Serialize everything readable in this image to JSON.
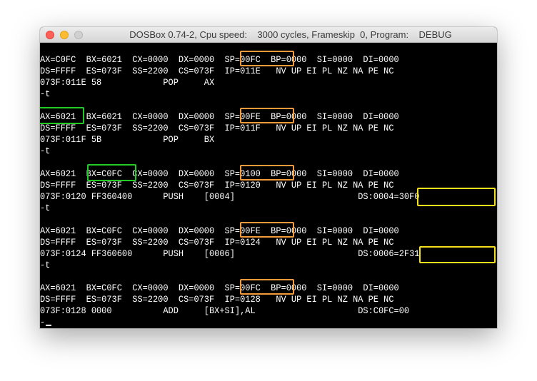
{
  "window": {
    "title": "DOSBox 0.74-2, Cpu speed:    3000 cycles, Frameskip  0, Program:    DEBUG"
  },
  "colors": {
    "sp_highlight": "#f39a3b",
    "register_highlight": "#22cc22",
    "memory_highlight": "#f4e11c",
    "terminal_bg": "#000000",
    "terminal_fg": "#ffffff"
  },
  "console": {
    "lines": [
      "AX=C0FC  BX=6021  CX=0000  DX=0000  SP=00FC  BP=0000  SI=0000  DI=0000",
      "DS=FFFF  ES=073F  SS=2200  CS=073F  IP=011E   NV UP EI PL NZ NA PE NC",
      "073F:011E 58            POP     AX",
      "-t",
      "",
      "AX=6021  BX=6021  CX=0000  DX=0000  SP=00FE  BP=0000  SI=0000  DI=0000",
      "DS=FFFF  ES=073F  SS=2200  CS=073F  IP=011F   NV UP EI PL NZ NA PE NC",
      "073F:011F 5B            POP     BX",
      "-t",
      "",
      "AX=6021  BX=C0FC  CX=0000  DX=0000  SP=0100  BP=0000  SI=0000  DI=0000",
      "DS=FFFF  ES=073F  SS=2200  CS=073F  IP=0120   NV UP EI PL NZ NA PE NC",
      "073F:0120 FF360400      PUSH    [0004]                        DS:0004=30F0",
      "-t",
      "",
      "AX=6021  BX=C0FC  CX=0000  DX=0000  SP=00FE  BP=0000  SI=0000  DI=0000",
      "DS=FFFF  ES=073F  SS=2200  CS=073F  IP=0124   NV UP EI PL NZ NA PE NC",
      "073F:0124 FF360600      PUSH    [0006]                        DS:0006=2F31",
      "-t",
      "",
      "AX=6021  BX=C0FC  CX=0000  DX=0000  SP=00FC  BP=0000  SI=0000  DI=0000",
      "DS=FFFF  ES=073F  SS=2200  CS=073F  IP=0128   NV UP EI PL NZ NA PE NC",
      "073F:0128 0000          ADD     [BX+SI],AL                    DS:C0FC=00",
      "-"
    ]
  }
}
